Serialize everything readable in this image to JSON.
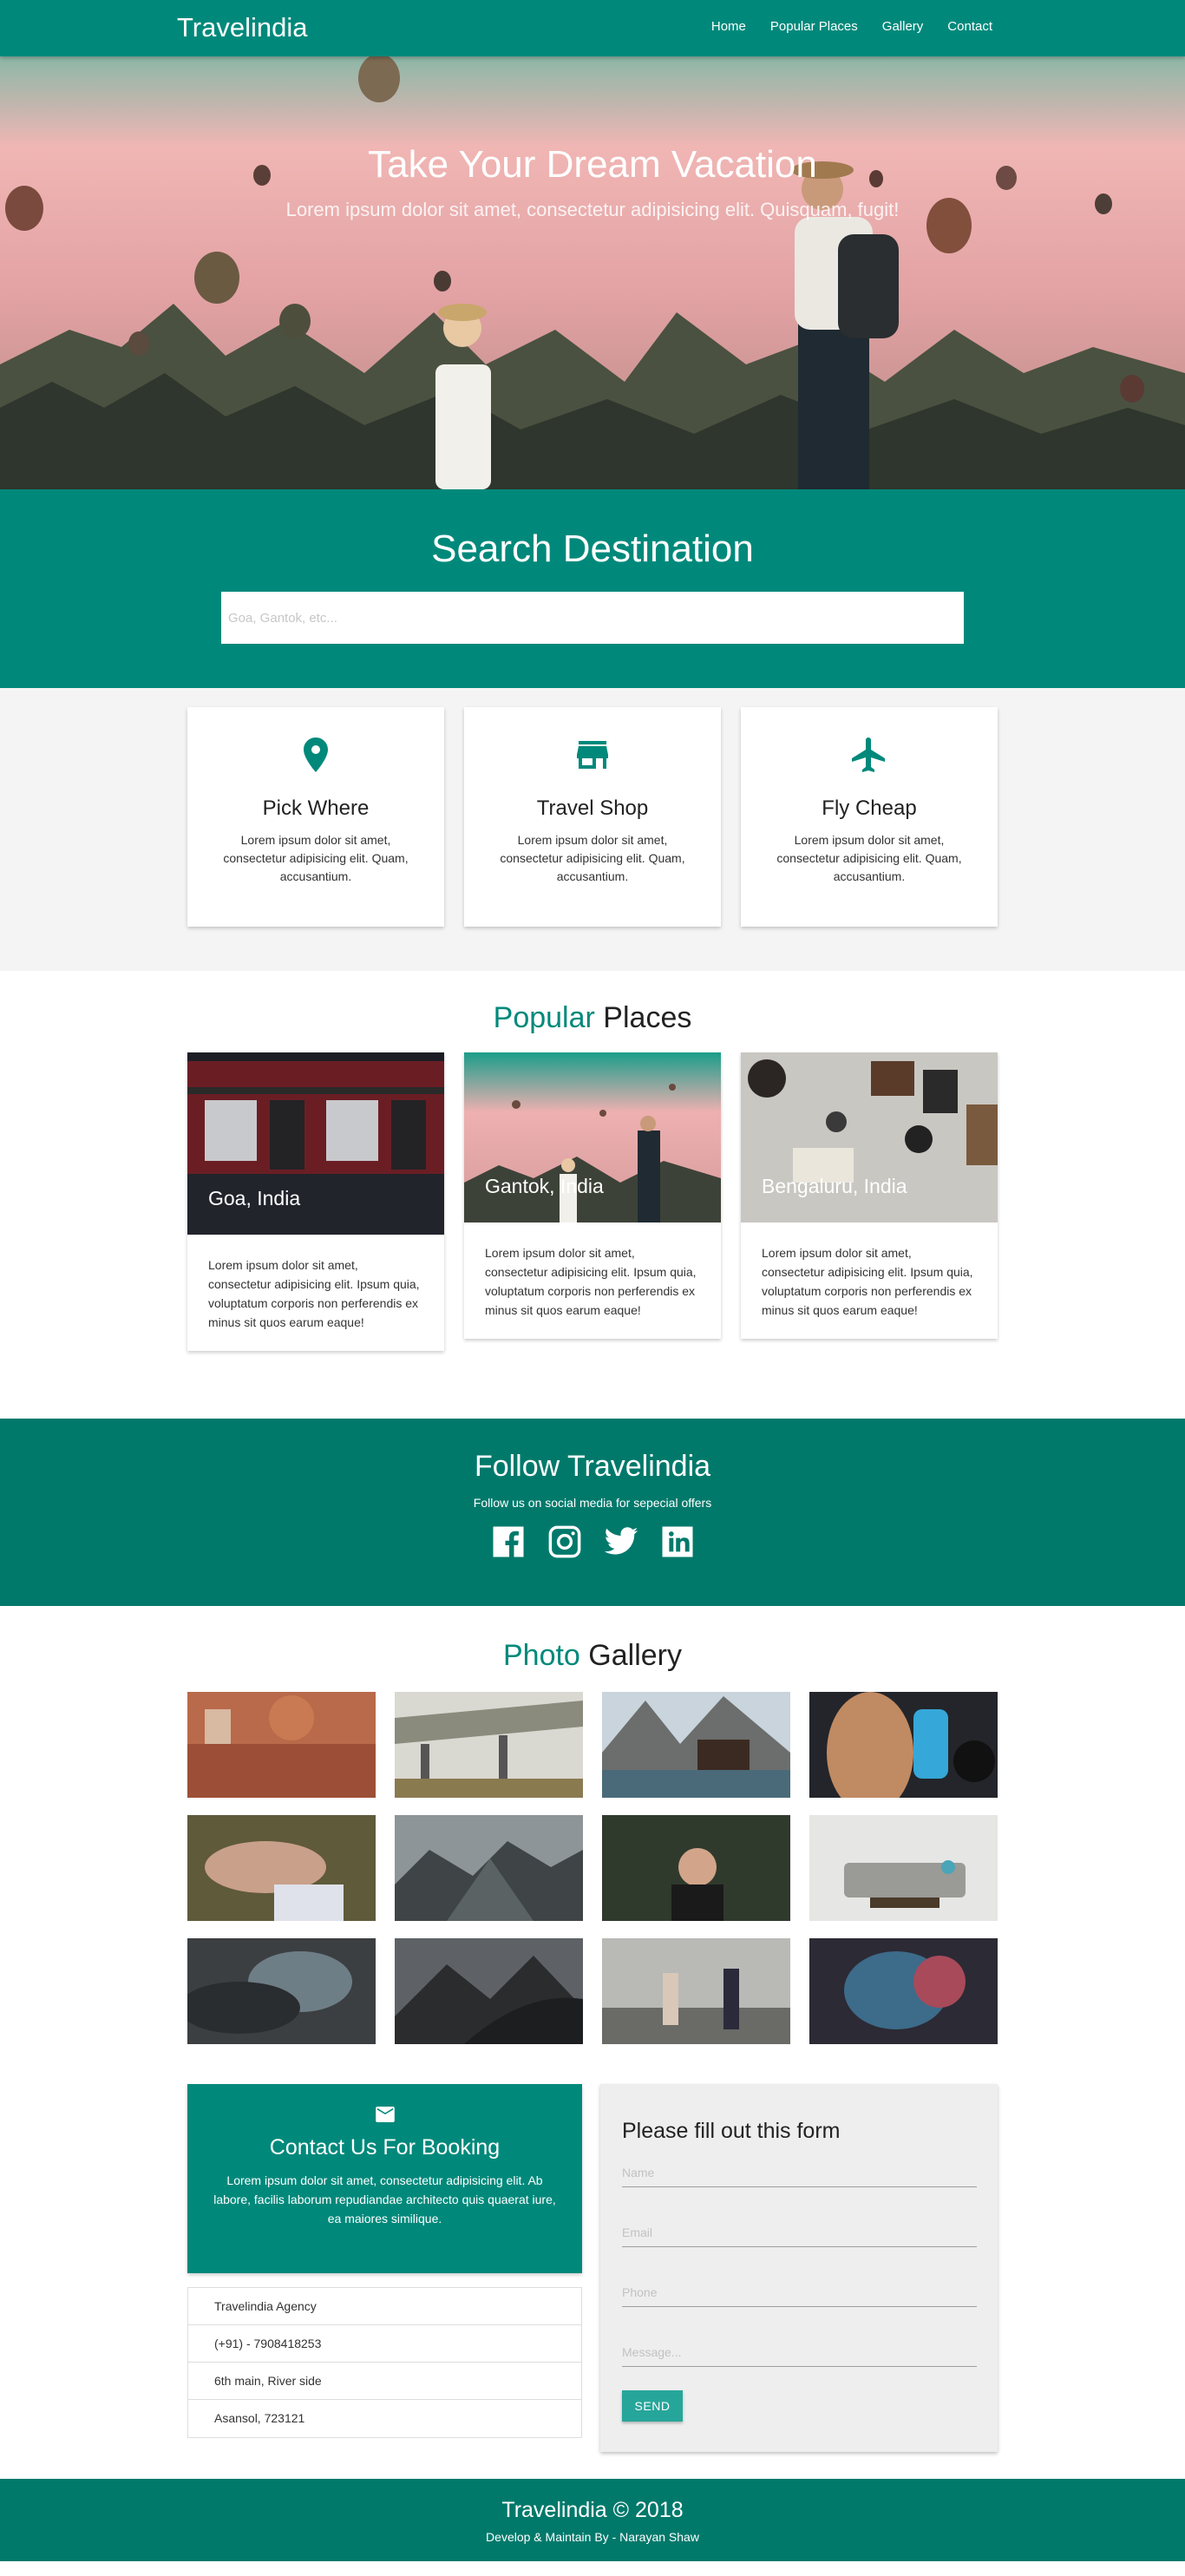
{
  "nav": {
    "brand": "Travelindia",
    "links": [
      "Home",
      "Popular Places",
      "Gallery",
      "Contact"
    ]
  },
  "hero": {
    "title": "Take Your Dream Vacation",
    "subtitle": "Lorem ipsum dolor sit amet, consectetur adipisicing elit. Quisquam, fugit!"
  },
  "search": {
    "title": "Search Destination",
    "placeholder": "Goa, Gantok, etc..."
  },
  "features": [
    {
      "icon": "location-pin-icon",
      "title": "Pick Where",
      "text": "Lorem ipsum dolor sit amet, consectetur adipisicing elit. Quam, accusantium."
    },
    {
      "icon": "store-icon",
      "title": "Travel Shop",
      "text": "Lorem ipsum dolor sit amet, consectetur adipisicing elit. Quam, accusantium."
    },
    {
      "icon": "airplane-icon",
      "title": "Fly Cheap",
      "text": "Lorem ipsum dolor sit amet, consectetur adipisicing elit. Quam, accusantium."
    }
  ],
  "popular": {
    "title_accent": "Popular",
    "title_rest": "Places",
    "places": [
      {
        "name": "Goa, India",
        "text": "Lorem ipsum dolor sit amet, consectetur adipisicing elit. Ipsum quia, voluptatum corporis non perferendis ex minus sit quos earum eaque!"
      },
      {
        "name": "Gantok, India",
        "text": "Lorem ipsum dolor sit amet, consectetur adipisicing elit. Ipsum quia, voluptatum corporis non perferendis ex minus sit quos earum eaque!"
      },
      {
        "name": "Bengaluru, India",
        "text": "Lorem ipsum dolor sit amet, consectetur adipisicing elit. Ipsum quia, voluptatum corporis non perferendis ex minus sit quos earum eaque!"
      }
    ]
  },
  "follow": {
    "title": "Follow Travelindia",
    "subtitle": "Follow us on social media for sepecial offers",
    "icons": [
      "facebook-icon",
      "instagram-icon",
      "twitter-icon",
      "linkedin-icon"
    ]
  },
  "gallery": {
    "title_accent": "Photo",
    "title_rest": "Gallery"
  },
  "contact": {
    "box_title": "Contact Us For Booking",
    "box_text": "Lorem ipsum dolor sit amet, consectetur adipisicing elit. Ab labore, facilis laborum repudiandae architecto quis quaerat iure, ea maiores similique.",
    "details": [
      "Travelindia Agency",
      "(+91) - 7908418253",
      "6th main, River side",
      "Asansol, 723121"
    ],
    "form_title": "Please fill out this form",
    "placeholders": {
      "name": "Name",
      "email": "Email",
      "phone": "Phone",
      "message": "Message..."
    },
    "send": "SEND"
  },
  "footer": {
    "title": "Travelindia © 2018",
    "credit": "Develop & Maintain By - Narayan Shaw"
  },
  "colors": {
    "primary": "#00897b",
    "dark": "#00796b",
    "button": "#26a69a"
  }
}
